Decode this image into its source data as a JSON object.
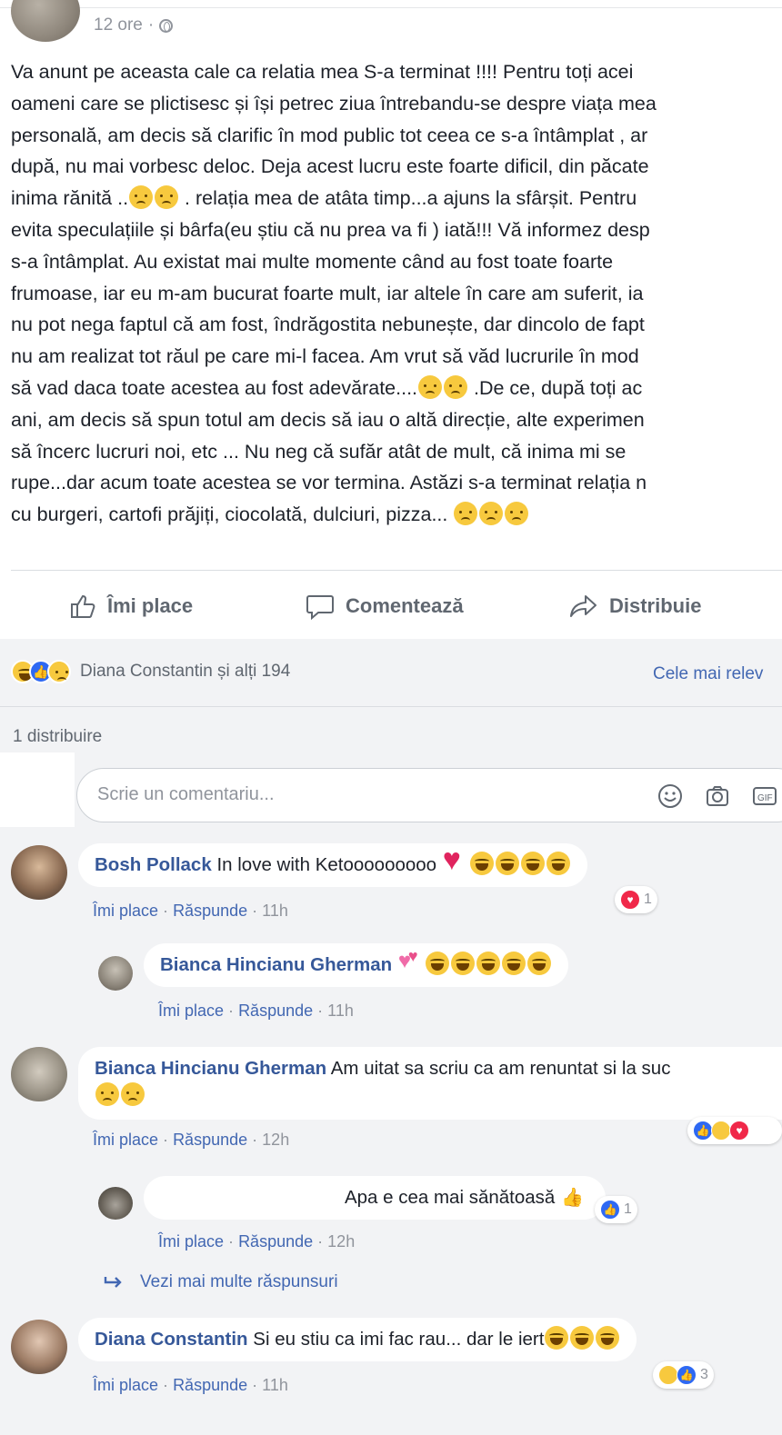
{
  "post": {
    "time": "12 ore",
    "privacy_icon": "globe-icon",
    "lines": [
      "Va anunt pe aceasta cale ca relatia mea S-a terminat !!!! Pentru toți acei",
      "oameni care se plictisesc și își petrec ziua întrebandu-se despre viața mea",
      "personală, am decis să clarific în mod public tot ceea ce s-a întâmplat , ar",
      "după, nu mai vorbesc deloc. Deja acest lucru este foarte dificil, din păcate",
      "inima rănită ..",
      "evita speculațiile și bârfa(eu știu că nu prea va fi ) iată!!! Vă informez desp",
      "s-a întâmplat. Au existat mai multe momente când au fost toate foarte",
      "frumoase, iar eu m-am bucurat foarte mult, iar altele în care am suferit, ia",
      "nu pot nega faptul că am fost, îndrăgostita nebunește, dar dincolo de fapt",
      "nu am realizat tot răul pe care mi-l facea. Am vrut să văd lucrurile în mod",
      "să vad daca toate acestea au fost adevărate....",
      "ani, am decis să spun totul am decis să iau o altă direcție, alte experimen",
      "să încerc lucruri noi, etc ... Nu neg că sufăr atât de mult, că inima mi se",
      "rupe...dar acum toate acestea se vor termina. Astăzi s-a terminat relația n",
      "cu burgeri, cartofi prăjiți, ciocolată, dulciuri, pizza..."
    ],
    "line5_tail": " . relația mea de atâta timp...a ajuns la sfârșit. Pentru",
    "line11_tail": " .De ce, după toți ac"
  },
  "actions": {
    "like": "Îmi place",
    "comment": "Comentează",
    "share": "Distribuie"
  },
  "reactions": {
    "names": "Diana Constantin și alți 194",
    "sort": "Cele mai relev",
    "shares": "1 distribuire"
  },
  "composer": {
    "placeholder": "Scrie un comentariu..."
  },
  "comments": [
    {
      "author": "Bosh Pollack",
      "text": " In love with Ketooooooooo ",
      "like": "Îmi place",
      "reply": "Răspunde",
      "time": "11h",
      "reaction_count": "1"
    },
    {
      "author": "Bianca Hincianu Gherman",
      "text": " ",
      "like": "Îmi place",
      "reply": "Răspunde",
      "time": "11h"
    },
    {
      "author": "Bianca Hincianu Gherman",
      "text": " Am uitat sa scriu ca am renuntat si la suc",
      "like": "Îmi place",
      "reply": "Răspunde",
      "time": "12h"
    },
    {
      "author": "",
      "text": "Apa e cea mai sănătoasă ",
      "like": "Îmi place",
      "reply": "Răspunde",
      "time": "12h",
      "reaction_count": "1"
    },
    {
      "author": "Diana Constantin",
      "text": " Si eu stiu ca imi fac rau... dar le iert",
      "like": "Îmi place",
      "reply": "Răspunde",
      "time": "11h",
      "reaction_count": "3"
    }
  ],
  "more_replies": "Vezi mai multe răspunsuri",
  "colors": {
    "link": "#365899",
    "meta_link": "#4267b2",
    "muted": "#90949c",
    "background": "#f2f3f5",
    "like_blue": "#2e69f3",
    "love_red": "#f02849",
    "haha_yellow": "#f7c93e"
  }
}
